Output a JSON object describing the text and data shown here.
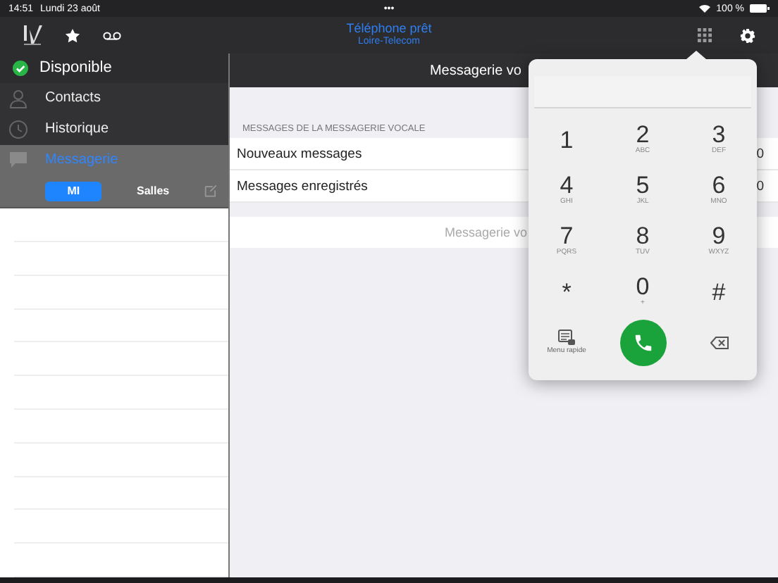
{
  "status_bar": {
    "time": "14:51",
    "date": "Lundi 23 août",
    "dots": "•••",
    "battery": "100 %"
  },
  "top_bar": {
    "title": "Téléphone prêt",
    "subtitle": "Loire-Telecom"
  },
  "sidebar": {
    "presence": {
      "label": "Disponible"
    },
    "items": [
      {
        "label": "Contacts",
        "selected": false
      },
      {
        "label": "Historique",
        "selected": false
      },
      {
        "label": "Messagerie",
        "selected": true
      }
    ],
    "segments": [
      {
        "label": "MI",
        "selected": true
      },
      {
        "label": "Salles",
        "selected": false
      }
    ]
  },
  "main": {
    "header": "Messagerie vo",
    "section_title": "MESSAGES DE LA MESSAGERIE VOCALE",
    "rows": [
      {
        "label": "Nouveaux messages",
        "count": "0"
      },
      {
        "label": "Messages enregistrés",
        "count": "0"
      }
    ],
    "voicemail_row": "Messagerie vo"
  },
  "dialpad": {
    "keys": [
      {
        "digit": "1"
      },
      {
        "digit": "2",
        "letters": "ABC"
      },
      {
        "digit": "3",
        "letters": "DEF"
      },
      {
        "digit": "4",
        "letters": "GHI"
      },
      {
        "digit": "5",
        "letters": "JKL"
      },
      {
        "digit": "6",
        "letters": "MNO"
      },
      {
        "digit": "7",
        "letters": "PQRS"
      },
      {
        "digit": "8",
        "letters": "TUV"
      },
      {
        "digit": "9",
        "letters": "WXYZ"
      },
      {
        "digit": "*"
      },
      {
        "digit": "0",
        "letters": "+"
      },
      {
        "digit": "#"
      }
    ],
    "quick_menu": "Menu rapide"
  }
}
